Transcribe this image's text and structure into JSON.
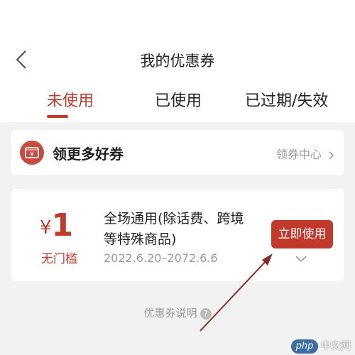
{
  "header": {
    "title": "我的优惠券"
  },
  "tabs": [
    {
      "label": "未使用",
      "active": true
    },
    {
      "label": "已使用",
      "active": false
    },
    {
      "label": "已过期/失效",
      "active": false
    }
  ],
  "promo_card": {
    "icon": "coupon-icon",
    "icon_symbol": "¥",
    "label": "领更多好券",
    "link_label": "领券中心"
  },
  "coupon": {
    "currency": "¥",
    "amount": "1",
    "threshold": "无门槛",
    "description": "全场通用(除话费、跨境等特殊商品)",
    "validity": "2022.6.20–2072.6.6",
    "use_button": "立即使用"
  },
  "coupon_explain": {
    "label": "优惠券说明",
    "help_symbol": "?"
  },
  "watermark": {
    "brand": "php",
    "site": "中文网"
  },
  "colors": {
    "accent": "#c0392b",
    "icon_bg": "#c94a3f",
    "background": "#f2f2f2",
    "annotation_arrow": "#8a2a22"
  }
}
